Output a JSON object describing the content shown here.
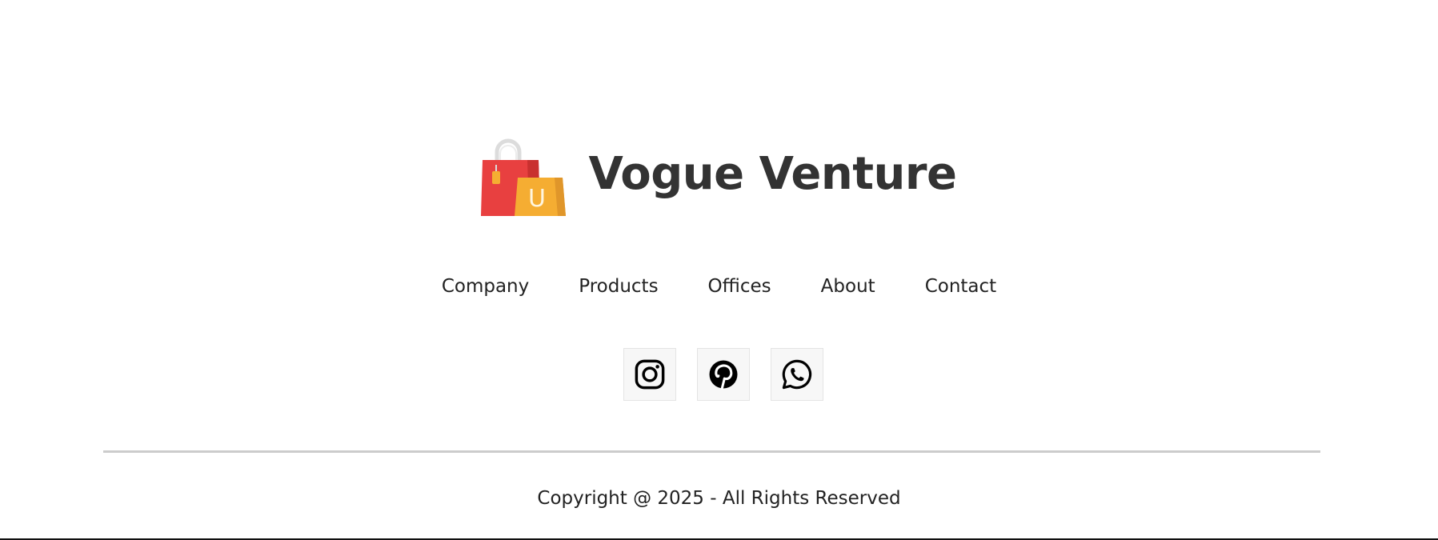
{
  "brand": {
    "name": "Vogue Venture",
    "logo_icon": "shopping-bags-icon",
    "logo_letter": "U"
  },
  "nav": {
    "items": [
      {
        "label": "Company"
      },
      {
        "label": "Products"
      },
      {
        "label": "Offices"
      },
      {
        "label": "About"
      },
      {
        "label": "Contact"
      }
    ]
  },
  "social": [
    {
      "icon": "instagram-icon"
    },
    {
      "icon": "pinterest-icon"
    },
    {
      "icon": "whatsapp-icon"
    }
  ],
  "footer": {
    "copyright": "Copyright @ 2025 - All Rights Reserved"
  },
  "colors": {
    "brand_text": "#333333",
    "bag_red": "#e84040",
    "bag_yellow": "#f5ad32",
    "divider": "#cccccc"
  }
}
